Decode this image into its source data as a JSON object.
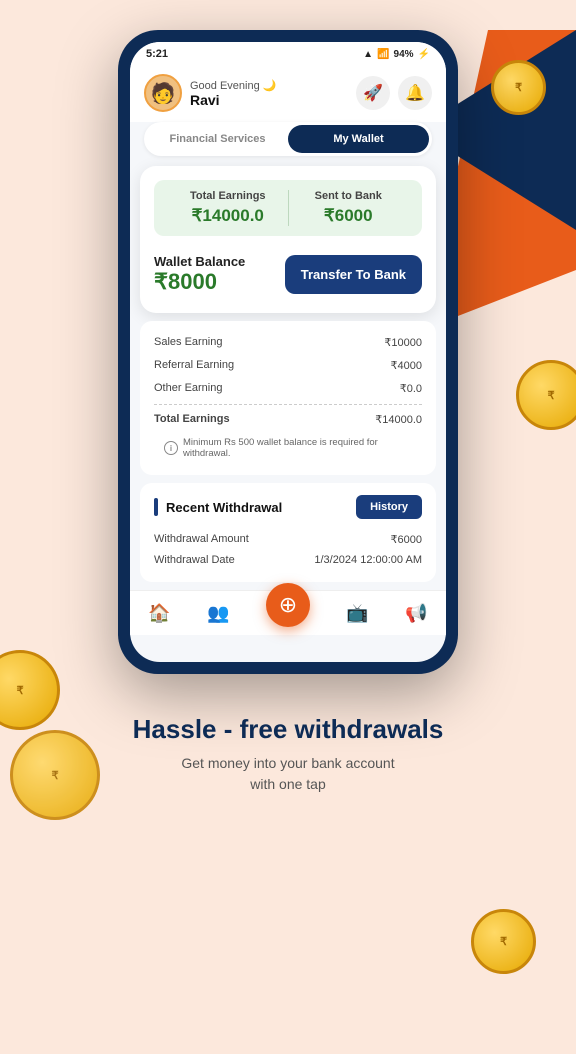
{
  "statusBar": {
    "time": "5:21",
    "battery": "94%",
    "batteryIcon": "🔋"
  },
  "header": {
    "greeting": "Good Evening 🌙",
    "userName": "Ravi",
    "rocketIcon": "🚀",
    "bellIcon": "🔔"
  },
  "tabs": [
    {
      "label": "Financial Services",
      "active": false
    },
    {
      "label": "My Wallet",
      "active": true
    }
  ],
  "wallet": {
    "totalEarningsLabel": "Total Earnings",
    "totalEarningsValue": "₹14000.0",
    "sentToBankLabel": "Sent to Bank",
    "sentToBankValue": "₹6000",
    "walletBalanceLabel": "Wallet Balance",
    "walletBalanceValue": "₹8000",
    "transferButtonLabel": "Transfer To Bank"
  },
  "earningsBreakdown": {
    "rows": [
      {
        "label": "Sales Earning",
        "value": "₹10000"
      },
      {
        "label": "Referral Earning",
        "value": "₹4000"
      },
      {
        "label": "Other Earning",
        "value": "₹0.0"
      }
    ],
    "totalLabel": "Total Earnings",
    "totalValue": "₹14000.0",
    "infoNote": "Minimum Rs 500 wallet balance is required for withdrawal."
  },
  "recentWithdrawal": {
    "sectionTitle": "Recent Withdrawal",
    "historyButtonLabel": "History",
    "rows": [
      {
        "label": "Withdrawal Amount",
        "value": "₹6000"
      },
      {
        "label": "Withdrawal Date",
        "value": "1/3/2024 12:00:00 AM"
      }
    ]
  },
  "bottomNav": {
    "items": [
      {
        "icon": "🏠",
        "name": "home"
      },
      {
        "icon": "👥",
        "name": "referral"
      },
      {
        "icon": "⊕",
        "name": "center",
        "center": true
      },
      {
        "icon": "📺",
        "name": "media"
      },
      {
        "icon": "📢",
        "name": "offers"
      }
    ]
  },
  "bottomSection": {
    "headline": "Hassle - free withdrawals",
    "subtext": "Get money into your bank account\nwith one tap"
  }
}
